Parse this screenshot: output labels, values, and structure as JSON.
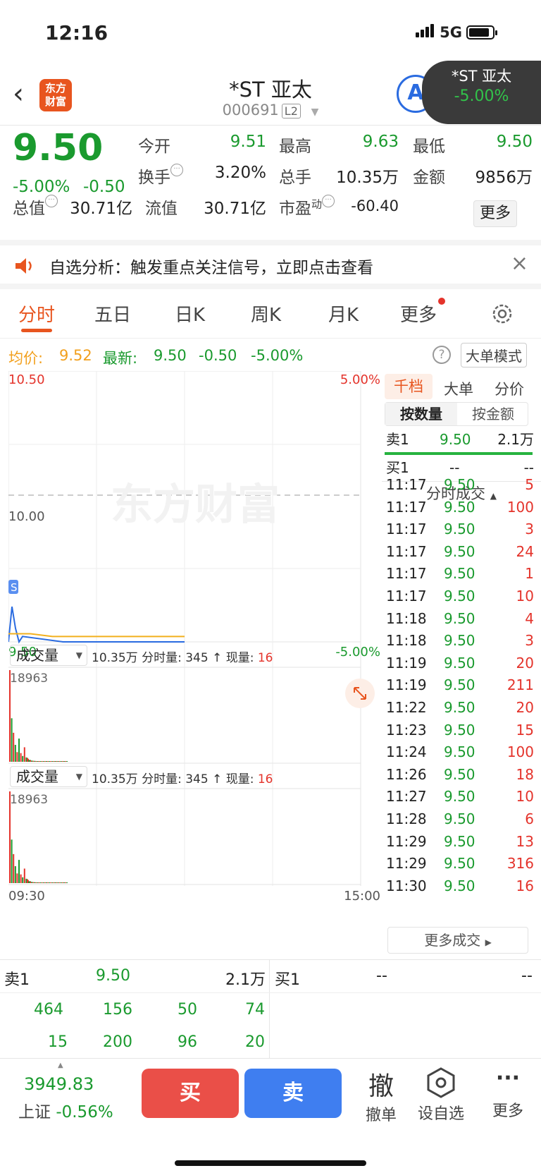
{
  "status": {
    "time": "12:16",
    "network": "5G"
  },
  "nav": {
    "logo_line1": "东方",
    "logo_line2": "财富",
    "title": "*ST 亚太",
    "code": "000691",
    "level": "L2",
    "a_label": "A",
    "float_name": "*ST 亚太",
    "float_pct": "-5.00%"
  },
  "quote": {
    "price": "9.50",
    "pct": "-5.00%",
    "change": "-0.50",
    "open_label": "今开",
    "open": "9.51",
    "high_label": "最高",
    "high": "9.63",
    "low_label": "最低",
    "low": "9.50",
    "turnover_label": "换手",
    "turnover": "3.20%",
    "volume_label": "总手",
    "volume": "10.35万",
    "amount_label": "金额",
    "amount": "9856万",
    "mktcap_label": "总值",
    "mktcap": "30.71亿",
    "float_label": "流值",
    "float_cap": "30.71亿",
    "pe_label": "市盈",
    "pe_sup": "动",
    "pe": "-60.40",
    "more": "更多"
  },
  "notice": {
    "text": "自选分析：触发重点关注信号，立即点击查看"
  },
  "tabs": [
    "分时",
    "五日",
    "日K",
    "周K",
    "月K",
    "更多"
  ],
  "avg": {
    "avg_label": "均价:",
    "avg": "9.52",
    "latest_label": "最新:",
    "latest": "9.50",
    "latest_chg": "-0.50",
    "latest_pct": "-5.00%",
    "mode_btn": "大单模式"
  },
  "chart": {
    "y_top": "10.50",
    "y_mid": "10.00",
    "y_bot": "9.50",
    "pct_top": "5.00%",
    "pct_bot": "-5.00%",
    "watermark": "东方财富",
    "s_mark": "S",
    "x_start": "09:30",
    "x_end": "15:00",
    "vol_label": "成交量",
    "vol_info_1": "10.35万 分时量: 345 ↑ 现量: ",
    "vol_now": "16",
    "vol_max": "18963"
  },
  "chart_data": {
    "type": "line",
    "title": "",
    "price_range": [
      9.5,
      10.5
    ],
    "prev_close": 10.0,
    "x_range": [
      "09:30",
      "15:00"
    ],
    "series": [
      {
        "name": "price",
        "color": "#2a6be0",
        "values": [
          9.5,
          9.63,
          9.55,
          9.5,
          9.52,
          9.5,
          9.5,
          9.5,
          9.5
        ]
      },
      {
        "name": "均价",
        "color": "#f2b01e",
        "values": [
          9.53,
          9.53,
          9.52,
          9.52,
          9.52,
          9.52,
          9.52,
          9.52,
          9.52
        ]
      }
    ],
    "volume_max": 18963,
    "volume": [
      18963,
      9000,
      6000,
      3500,
      2000,
      4800,
      1800,
      1200,
      3000,
      900,
      600,
      400,
      800,
      350,
      300,
      250,
      200,
      180,
      150,
      120,
      100,
      90,
      80,
      70,
      60,
      55,
      50,
      45,
      40,
      35,
      30,
      30,
      25,
      25,
      20,
      20,
      18,
      18,
      16,
      16
    ]
  },
  "rp": {
    "tab1": "千档",
    "tab2": "大单",
    "tab3": "分价",
    "sub1": "按数量",
    "sub2": "按金额",
    "sell1_label": "卖1",
    "sell1_price": "9.50",
    "sell1_vol": "2.1万",
    "buy1_label": "买1",
    "buy1_price": "--",
    "buy1_vol": "--",
    "ticks_title": "分时成交",
    "ticks": [
      {
        "t": "11:17",
        "p": "9.50",
        "v": "5"
      },
      {
        "t": "11:17",
        "p": "9.50",
        "v": "100"
      },
      {
        "t": "11:17",
        "p": "9.50",
        "v": "3"
      },
      {
        "t": "11:17",
        "p": "9.50",
        "v": "24"
      },
      {
        "t": "11:17",
        "p": "9.50",
        "v": "1"
      },
      {
        "t": "11:17",
        "p": "9.50",
        "v": "10"
      },
      {
        "t": "11:18",
        "p": "9.50",
        "v": "4"
      },
      {
        "t": "11:18",
        "p": "9.50",
        "v": "3"
      },
      {
        "t": "11:19",
        "p": "9.50",
        "v": "20"
      },
      {
        "t": "11:19",
        "p": "9.50",
        "v": "211"
      },
      {
        "t": "11:22",
        "p": "9.50",
        "v": "20"
      },
      {
        "t": "11:23",
        "p": "9.50",
        "v": "15"
      },
      {
        "t": "11:24",
        "p": "9.50",
        "v": "100"
      },
      {
        "t": "11:26",
        "p": "9.50",
        "v": "18"
      },
      {
        "t": "11:27",
        "p": "9.50",
        "v": "10"
      },
      {
        "t": "11:28",
        "p": "9.50",
        "v": "6"
      },
      {
        "t": "11:29",
        "p": "9.50",
        "v": "13"
      },
      {
        "t": "11:29",
        "p": "9.50",
        "v": "316"
      },
      {
        "t": "11:30",
        "p": "9.50",
        "v": "16"
      }
    ],
    "more_ticks": "更多成交"
  },
  "big": {
    "sell_label": "卖1",
    "sell_price": "9.50",
    "sell_vol": "2.1万",
    "buy_label": "买1",
    "buy_price": "--",
    "buy_vol": "--",
    "row1": [
      "464",
      "156",
      "50",
      "74"
    ],
    "row2": [
      "15",
      "200",
      "96",
      "20"
    ]
  },
  "bottom": {
    "index_val": "3949.83",
    "index_name": "上证",
    "index_pct": "-0.56%",
    "buy": "买",
    "sell": "卖",
    "cancel_icon": "撤",
    "cancel": "撤单",
    "watch": "设自选",
    "more": "更多"
  }
}
